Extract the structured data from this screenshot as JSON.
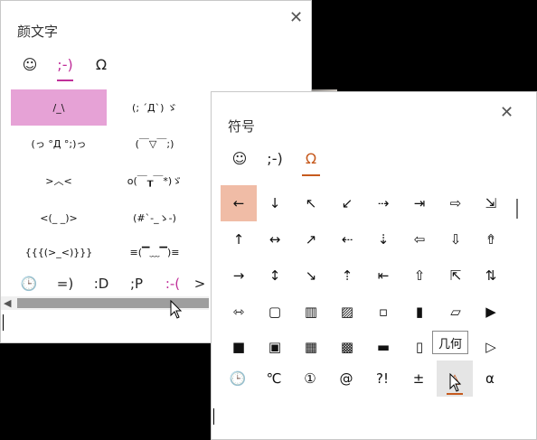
{
  "kaomoji_panel": {
    "title": "颜文字",
    "close_glyph": "✕",
    "categories": [
      {
        "glyph": "☺"
      },
      {
        "glyph": ";-)"
      },
      {
        "glyph": "Ω"
      }
    ],
    "items": [
      "/_\\",
      "(; ´Д`) ゞ",
      "(っ °Д °;)っ",
      "(￣▽￣;)",
      ">︿<",
      "o(￣┰￣*)ゞ",
      "<(_ _)>",
      "(#`-_ゝ-)",
      "{{{(>_<)}}}",
      "≡(▔﹏▔)≡"
    ],
    "filter_tabs": [
      "🕒",
      "=)",
      ":D",
      ";P",
      ":-(",
      ">"
    ]
  },
  "symbol_panel": {
    "title": "符号",
    "close_glyph": "✕",
    "categories": [
      {
        "glyph": "☺"
      },
      {
        "glyph": ";-)"
      },
      {
        "glyph": "Ω"
      }
    ],
    "symbols": [
      "←",
      "↓",
      "↖",
      "↙",
      "⇢",
      "⇥",
      "⇨",
      "⇲",
      "↑",
      "↔",
      "↗",
      "⇠",
      "⇣",
      "⇦",
      "⇩",
      "⇮",
      "→",
      "↕",
      "↘",
      "⇡",
      "⇤",
      "⇧",
      "⇱",
      "⇅",
      "⇿",
      "▢",
      "▥",
      "▨",
      "▫",
      "▮",
      "▱",
      "▶",
      "■",
      "▣",
      "▦",
      "▩",
      "▬",
      "▯",
      "",
      "▷"
    ],
    "filter_tabs": [
      "🕒",
      "℃",
      "①",
      "@",
      "?!",
      "±",
      "△",
      "α"
    ],
    "tooltip": "几何"
  },
  "colors": {
    "kaomoji_selected": "#e6a2d6",
    "kaomoji_accent": "#c0309a",
    "symbol_selected": "#f0bca6",
    "symbol_accent": "#c65a1e"
  }
}
